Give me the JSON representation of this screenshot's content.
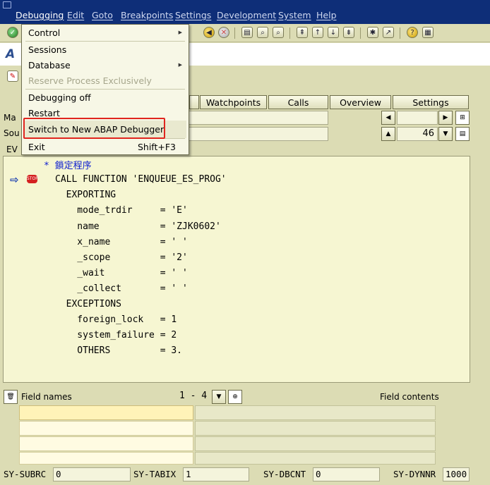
{
  "menubar": {
    "items": [
      "Debugging",
      "Edit",
      "Goto",
      "Breakpoints",
      "Settings",
      "Development",
      "System",
      "Help"
    ]
  },
  "title": {
    "text": "A"
  },
  "tabs": [
    "Watchpoints",
    "Calls",
    "Overview",
    "Settings"
  ],
  "fields": {
    "ma_label": "Ma",
    "sou_label": "Sou",
    "ev_label": "EV",
    "line_number": "46"
  },
  "editor": {
    "lines": [
      "* 鎖定程序",
      "CALL FUNCTION 'ENQUEUE_ES_PROG'",
      "  EXPORTING",
      "    mode_trdir     = 'E'",
      "    name           = 'ZJK0602'",
      "    x_name         = ' '",
      "    _scope         = '2'",
      "    _wait          = ' '",
      "    _collect       = ' '",
      "  EXCEPTIONS",
      "    foreign_lock   = 1",
      "    system_failure = 2",
      "    OTHERS         = 3."
    ]
  },
  "fieldlist": {
    "field_names_label": "Field names",
    "range": "1  -  4",
    "field_contents_label": "Field contents"
  },
  "status": {
    "subrc_label": "SY-SUBRC",
    "subrc_value": "0",
    "tabix_label": "SY-TABIX",
    "tabix_value": "1",
    "dbcnt_label": "SY-DBCNT",
    "dbcnt_value": "0",
    "dynnr_label": "SY-DYNNR",
    "dynnr_value": "1000"
  },
  "dropdown": {
    "control": "Control",
    "sessions": "Sessions",
    "database": "Database",
    "reserve": "Reserve Process Exclusively",
    "debugging_off": "Debugging off",
    "restart": "Restart",
    "switch": "Switch to New ABAP Debugger",
    "exit": "Exit",
    "exit_shortcut": "Shift+F3"
  },
  "colors": {
    "menubar_bg": "#0e2e78",
    "body_bg": "#dcdcb4",
    "highlight_border": "#e0251e",
    "comment_color": "#1020d0"
  }
}
